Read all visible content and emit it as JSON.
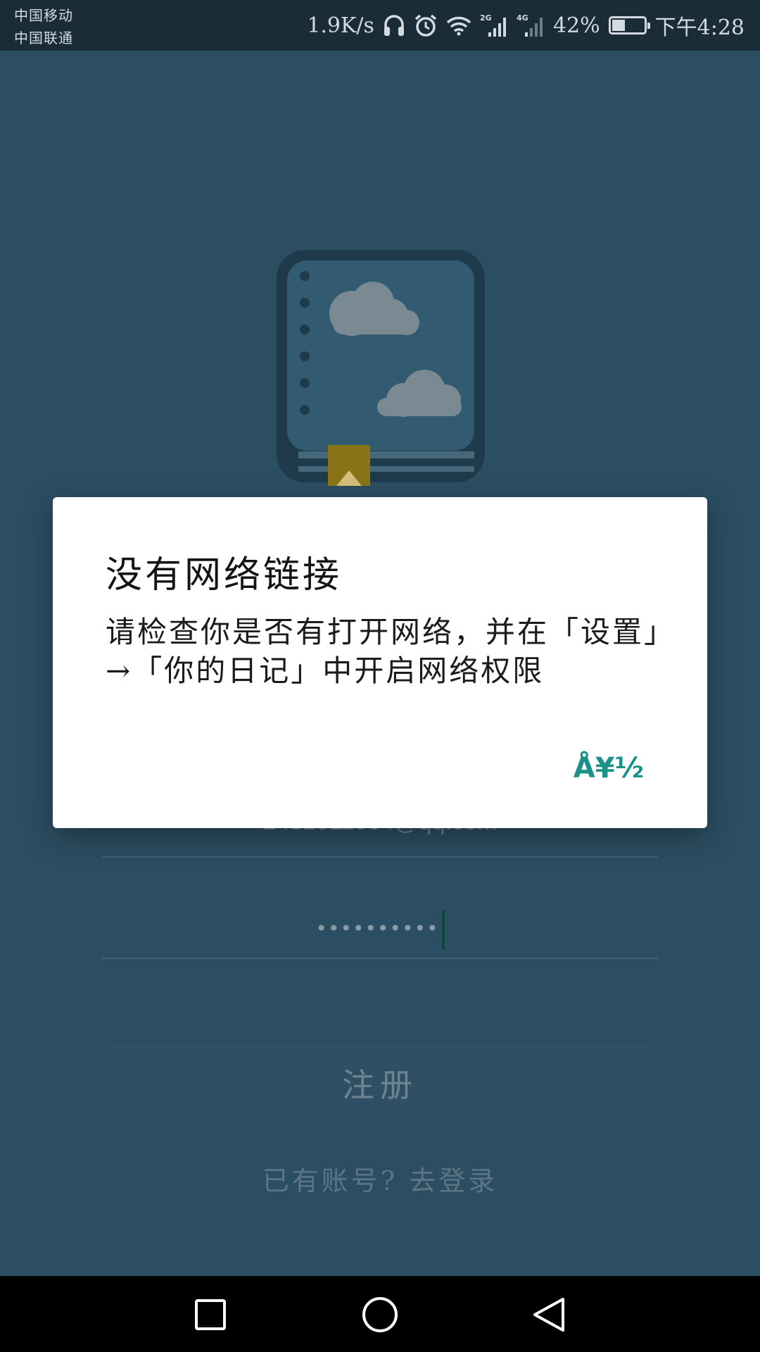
{
  "status_bar": {
    "carrier_1": "中国移动",
    "carrier_2": "中国联通",
    "net_speed": "1.9K/s",
    "icons": [
      "headphones-icon",
      "alarm-icon",
      "wifi-icon",
      "signal-2g-icon",
      "signal-4g-icon"
    ],
    "signal_2g_label": "2G",
    "signal_4g_label": "4G",
    "battery_percent_text": "42%",
    "battery_level": 0.42,
    "time": "下午4:28"
  },
  "background": {
    "logo_icon": "diary-book-icon",
    "email_value": "2432511904@qq.com",
    "password_value": "••••••••••",
    "register_label": "注册",
    "login_link": "已有账号? 去登录"
  },
  "dialog": {
    "title": "没有网络链接",
    "message": "请检查你是否有打开网络，并在「设置」→「你的日记」中开启网络权限",
    "ok_label": "Å¥½"
  },
  "nav_bar": {
    "icons": [
      "recents-square-icon",
      "home-circle-icon",
      "back-triangle-icon"
    ]
  },
  "colors": {
    "app_background": "#2c4e62",
    "status_bar": "#1a2c37",
    "dialog_accent": "#1d9089",
    "dialog_background": "#ffffff"
  }
}
